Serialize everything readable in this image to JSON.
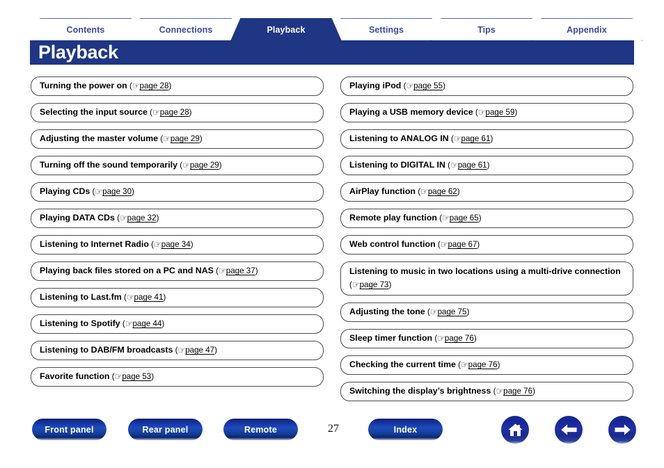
{
  "header": {
    "title": "Playback",
    "accent_color": "#1f3685",
    "tab_text_color": "#3b4a9e",
    "tabs": [
      {
        "label": "Contents",
        "active": false
      },
      {
        "label": "Connections",
        "active": false
      },
      {
        "label": "Playback",
        "active": true
      },
      {
        "label": "Settings",
        "active": false
      },
      {
        "label": "Tips",
        "active": false
      },
      {
        "label": "Appendix",
        "active": false
      }
    ]
  },
  "reference_icon": "pointing-hand-icon",
  "reference_glyph": "☞",
  "columns": {
    "left": [
      {
        "title": "Turning the power on",
        "page_label": "page 28"
      },
      {
        "title": "Selecting the input source",
        "page_label": "page 28"
      },
      {
        "title": "Adjusting the master volume",
        "page_label": "page 29"
      },
      {
        "title": "Turning off the sound temporarily",
        "page_label": "page 29"
      },
      {
        "title": "Playing CDs",
        "page_label": "page 30"
      },
      {
        "title": "Playing DATA CDs",
        "page_label": "page 32"
      },
      {
        "title": "Listening to Internet Radio",
        "page_label": "page 34"
      },
      {
        "title": "Playing back files stored on a PC and NAS",
        "page_label": "page 37"
      },
      {
        "title": "Listening to Last.fm",
        "page_label": "page 41"
      },
      {
        "title": "Listening to Spotify",
        "page_label": "page 44"
      },
      {
        "title": "Listening to DAB/FM broadcasts",
        "page_label": "page 47"
      },
      {
        "title": "Favorite function",
        "page_label": "page 53"
      }
    ],
    "right": [
      {
        "title": "Playing iPod",
        "page_label": "page 55"
      },
      {
        "title": "Playing a USB memory device",
        "page_label": "page 59"
      },
      {
        "title": "Listening to ANALOG IN",
        "page_label": "page 61"
      },
      {
        "title": "Listening to DIGITAL IN",
        "page_label": "page 61"
      },
      {
        "title": "AirPlay function",
        "page_label": "page 62"
      },
      {
        "title": "Remote play function",
        "page_label": "page 65"
      },
      {
        "title": "Web control function",
        "page_label": "page 67"
      },
      {
        "title": "Listening to music in two locations using a multi-drive connection",
        "page_label": "page 73",
        "two_line": true
      },
      {
        "title": "Adjusting the tone",
        "page_label": "page 75"
      },
      {
        "title": "Sleep timer function",
        "page_label": "page 76"
      },
      {
        "title": "Checking the current time",
        "page_label": "page 76"
      },
      {
        "title": "Switching the display’s brightness",
        "page_label": "page 76"
      }
    ]
  },
  "footer": {
    "buttons": [
      {
        "label": "Front panel"
      },
      {
        "label": "Rear panel"
      },
      {
        "label": "Remote"
      },
      {
        "label": "Index"
      }
    ],
    "page_number": "27",
    "icon_buttons": [
      {
        "name": "home-icon"
      },
      {
        "name": "arrow-left-icon"
      },
      {
        "name": "arrow-right-icon"
      }
    ]
  }
}
